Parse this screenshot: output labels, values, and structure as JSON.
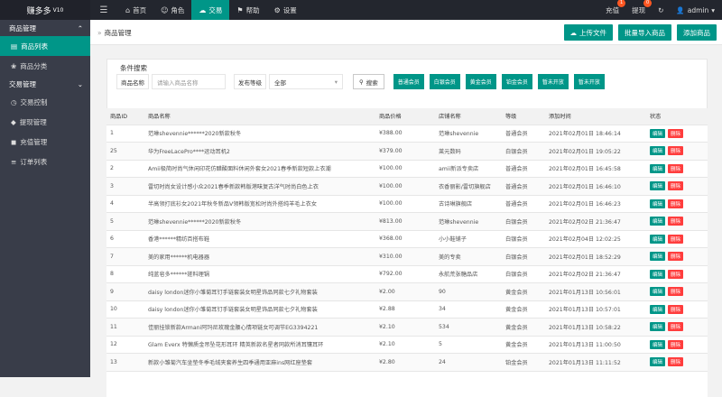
{
  "app": {
    "title": "赚多多",
    "version": "V10"
  },
  "nav": [
    {
      "label": "首页",
      "icon": "home-icon",
      "glyph": "⌂"
    },
    {
      "label": "角色",
      "icon": "user-icon",
      "glyph": "☺"
    },
    {
      "label": "交易",
      "icon": "cloud-icon",
      "glyph": "☁"
    },
    {
      "label": "帮助",
      "icon": "flag-icon",
      "glyph": "⚑"
    },
    {
      "label": "设置",
      "icon": "gear-icon",
      "glyph": "⚙"
    }
  ],
  "top_right": {
    "recharge": "充值",
    "recharge_badge": "1",
    "withdraw": "提现",
    "withdraw_badge": "0",
    "refresh_glyph": "↻",
    "user": "admin"
  },
  "sidebar": {
    "groups": [
      {
        "label": "商品管理",
        "items": [
          {
            "label": "商品列表",
            "icon": "list-icon",
            "glyph": "▤"
          },
          {
            "label": "商品分类",
            "icon": "category-icon",
            "glyph": "❀"
          }
        ]
      },
      {
        "label": "交易管理",
        "items": [
          {
            "label": "交易控制",
            "icon": "control-icon",
            "glyph": "◷"
          },
          {
            "label": "提现管理",
            "icon": "withdraw-icon",
            "glyph": "◆"
          },
          {
            "label": "充值管理",
            "icon": "recharge-icon",
            "glyph": "◼"
          },
          {
            "label": "订单列表",
            "icon": "order-icon",
            "glyph": "≡"
          }
        ]
      }
    ]
  },
  "breadcrumb": {
    "sep": "»",
    "label": "商品管理"
  },
  "toolbar": {
    "upload": "上传文件",
    "batch": "批量导入商品",
    "add": "添加商品"
  },
  "search": {
    "title": "条件搜索",
    "name_label": "商品名称",
    "name_placeholder": "请输入商品名称",
    "level_label": "发布等级",
    "level_value": "全部",
    "search_btn": "搜索",
    "levels": [
      "普通会员",
      "白银会员",
      "黄金会员",
      "铂金会员",
      "暂未开放",
      "暂未开放"
    ]
  },
  "table": {
    "headers": [
      "商品ID",
      "商品名称",
      "商品价格",
      "店铺名称",
      "等级",
      "添加时间",
      "状态"
    ],
    "edit_label": "编辑",
    "delete_label": "删除",
    "rows": [
      [
        "1",
        "范琳shevennie******2020新款秋冬",
        "¥388.00",
        "范琳shevennie",
        "普通会员",
        "2021年02月01日 18:46:14"
      ],
      [
        "25",
        "华为FreeLacePro****运动耳机2",
        "¥379.00",
        "莱元数码",
        "白银会员",
        "2021年02月01日 19:05:22"
      ],
      [
        "2",
        "Amii极简时尚气休闲印花仿醋酸面料休闲外套女2021春季新款短款上衣潮",
        "¥100.00",
        "amii新派专卖店",
        "普通会员",
        "2021年02月01日 16:45:58"
      ],
      [
        "3",
        "雷切时尚女设计感小众2021春季新款韩版港味复古洋气时尚白色上衣",
        "¥100.00",
        "衣香丽影/雷切旗舰店",
        "普通会员",
        "2021年02月01日 16:46:10"
      ],
      [
        "4",
        "半高领打底衫女2021年秋冬新品V领韩版宽松时尚外搭纯羊毛上衣女",
        "¥100.00",
        "古诗琳旗舰店",
        "普通会员",
        "2021年02月01日 16:46:23"
      ],
      [
        "5",
        "范琳shevennie******2020新款秋冬",
        "¥813.00",
        "范琳shevennie",
        "白银会员",
        "2021年02月02日 21:36:47"
      ],
      [
        "6",
        "香港******精纺百搭布鞋",
        "¥368.00",
        "小小鞋铺子",
        "白银会员",
        "2021年02月04日 12:02:25"
      ],
      [
        "7",
        "美的家用******机电器器",
        "¥310.00",
        "美的专卖",
        "白银会员",
        "2021年02月01日 18:52:29"
      ],
      [
        "8",
        "纯蓝皂多******搓料理锅",
        "¥792.00",
        "永航荒张糖品店",
        "白银会员",
        "2021年02月02日 21:36:47"
      ],
      [
        "9",
        "daisy london迷你小雏菊耳钉手链套装女明星饰品同款七夕礼物套装",
        "¥2.00",
        "90",
        "黄金会员",
        "2021年01月13日 10:56:01"
      ],
      [
        "10",
        "daisy london迷你小雏菊耳钉手链套装女明星饰品同款七夕礼物套装",
        "¥2.88",
        "34",
        "黄金会员",
        "2021年01月13日 10:57:01"
      ],
      [
        "11",
        "佳丽挂锁新款Armani阿玛尼玫瑰金腰心情项链女可调节EG3394221",
        "¥2.10",
        "534",
        "黄金会员",
        "2021年01月13日 10:58:22"
      ],
      [
        "12",
        "Glam Everx 特懒质金吊坠花形耳环 精英新款名星者同款所消耳镶耳环",
        "¥2.10",
        "5",
        "黄金会员",
        "2021年01月13日 11:00:50"
      ],
      [
        "13",
        "新款小雏菊汽车坐垫冬季毛绒夹套养生四季通用亚麻ins网红座垫套",
        "¥2.80",
        "24",
        "铂金会员",
        "2021年01月13日 11:11:52"
      ]
    ]
  }
}
